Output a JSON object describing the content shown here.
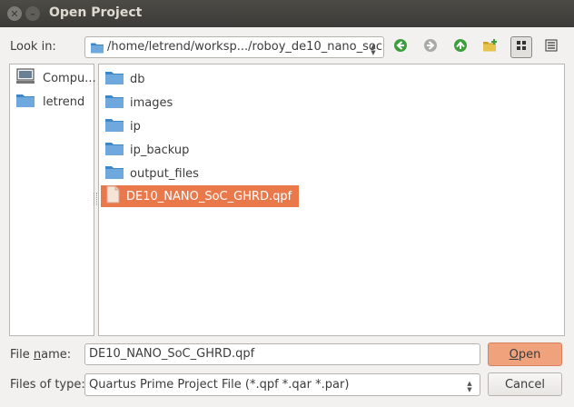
{
  "window": {
    "title": "Open Project"
  },
  "look_in": {
    "label": "Look in:",
    "path": "/home/letrend/worksp.../roboy_de10_nano_soc"
  },
  "toolbar": {
    "back": "back-arrow-icon",
    "forward": "forward-arrow-icon",
    "parent": "up-arrow-icon",
    "new_folder": "new-folder-icon",
    "list_view": "list-view-icon",
    "detail_view": "detail-view-icon"
  },
  "sidebar": {
    "items": [
      {
        "label": "Compu...",
        "icon": "computer-icon"
      },
      {
        "label": "letrend",
        "icon": "folder-icon"
      }
    ]
  },
  "files": {
    "items": [
      {
        "name": "db",
        "icon": "folder-icon"
      },
      {
        "name": "images",
        "icon": "folder-icon"
      },
      {
        "name": "ip",
        "icon": "folder-icon"
      },
      {
        "name": "ip_backup",
        "icon": "folder-icon"
      },
      {
        "name": "output_files",
        "icon": "folder-icon"
      },
      {
        "name": "DE10_NANO_SoC_GHRD.qpf",
        "icon": "file-icon",
        "selected": true
      }
    ]
  },
  "filename": {
    "label": "File name:",
    "value": "DE10_NANO_SoC_GHRD.qpf"
  },
  "filetype": {
    "label": "Files of type:",
    "value": "Quartus Prime Project File (*.qpf *.qar *.par)"
  },
  "buttons": {
    "open": "Open",
    "cancel": "Cancel"
  },
  "colors": {
    "selection": "#e9794b",
    "open_button": "#f0a27d",
    "folder": "#5b9bd5",
    "titlebar": "#3c3b37"
  }
}
